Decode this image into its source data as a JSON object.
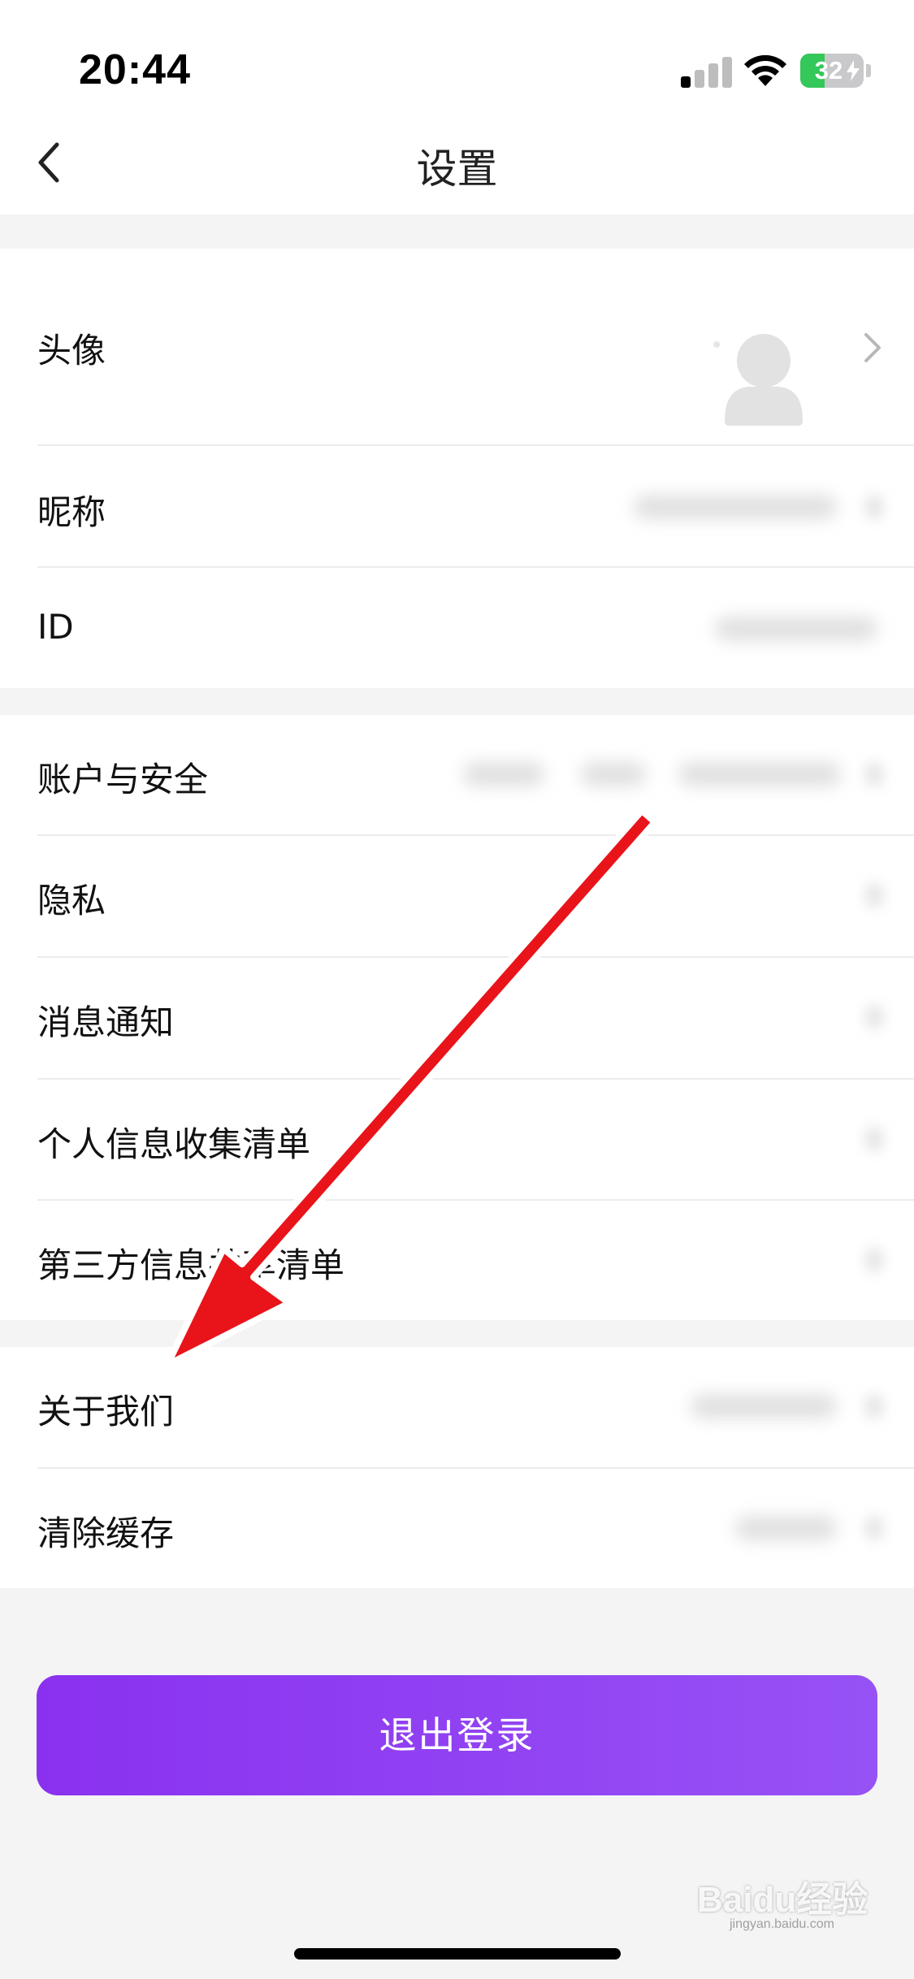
{
  "status_bar": {
    "time": "20:44",
    "battery_level": "32",
    "signal_bars_filled": 1,
    "signal_bars_total": 4,
    "icons": [
      "signal-icon",
      "wifi-icon",
      "battery-icon"
    ],
    "battery_color": "#34c759"
  },
  "nav": {
    "back_icon": "chevron-left-icon",
    "title": "设置"
  },
  "sections": {
    "profile": {
      "avatar_label": "头像",
      "nickname_label": "昵称",
      "id_label": "ID"
    },
    "settings": {
      "account_label": "账户与安全",
      "privacy_label": "隐私",
      "notifications_label": "消息通知",
      "personal_info_label": "个人信息收集清单",
      "third_party_label": "第三方信息共享清单"
    },
    "misc": {
      "about_label": "关于我们",
      "cache_label": "清除缓存"
    }
  },
  "logout": {
    "label": "退出登录",
    "color_start": "#8a31f0",
    "color_end": "#9752f5"
  },
  "watermark": {
    "brand": "Baidu经验",
    "url": "jingyan.baidu.com"
  },
  "annotation": {
    "type": "red-arrow",
    "color": "#e8141a",
    "points_to": "about_label"
  }
}
